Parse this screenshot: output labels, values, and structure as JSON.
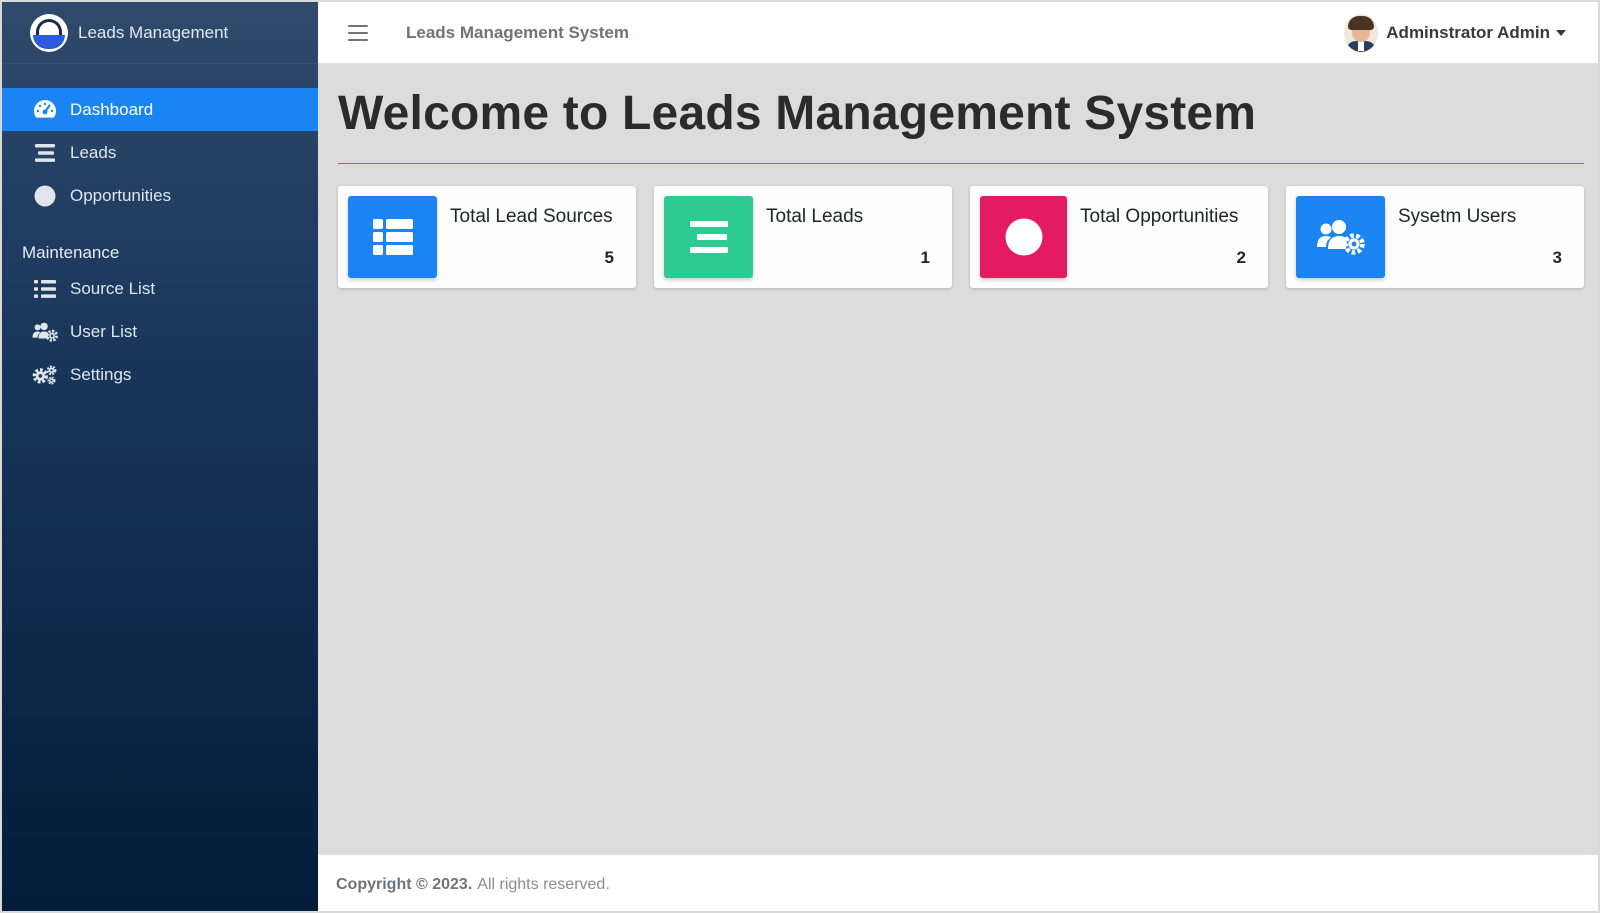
{
  "brand": {
    "name": "Leads Management"
  },
  "topbar": {
    "title": "Leads Management System",
    "user_name": "Adminstrator Admin"
  },
  "sidebar": {
    "items": [
      {
        "label": "Dashboard",
        "icon": "dashboard-icon",
        "active": true
      },
      {
        "label": "Leads",
        "icon": "bars-icon"
      },
      {
        "label": "Opportunities",
        "icon": "circle-icon"
      }
    ],
    "section_header": "Maintenance",
    "maintenance_items": [
      {
        "label": "Source List",
        "icon": "list-icon"
      },
      {
        "label": "User List",
        "icon": "users-cog-icon"
      },
      {
        "label": "Settings",
        "icon": "cogs-icon"
      }
    ]
  },
  "main": {
    "title": "Welcome to Leads Management System",
    "cards": [
      {
        "label": "Total Lead Sources",
        "value": "5",
        "color": "#1a84f3",
        "icon": "th-list-icon"
      },
      {
        "label": "Total Leads",
        "value": "1",
        "color": "#2dcb91",
        "icon": "bars-icon"
      },
      {
        "label": "Total Opportunities",
        "value": "2",
        "color": "#e31b63",
        "icon": "circle-icon"
      },
      {
        "label": "Sysetm Users",
        "value": "3",
        "color": "#1a84f3",
        "icon": "users-cog-icon"
      }
    ]
  },
  "footer": {
    "copyright": "Copyright © 2023.",
    "rights": "All rights reserved."
  },
  "colors": {
    "sidebar_top": "#2f4a6b",
    "sidebar_bottom": "#041c3b",
    "accent": "#1a84f3",
    "content_bg": "#dcdcdc"
  }
}
